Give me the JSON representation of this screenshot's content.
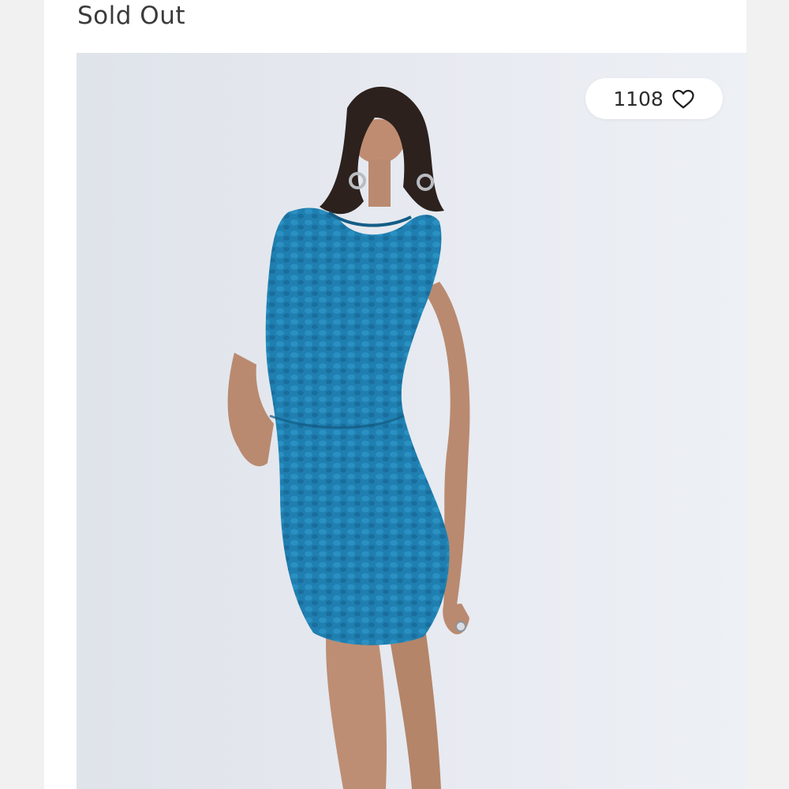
{
  "listing": {
    "status": "Sold Out",
    "likes": "1108"
  },
  "icons": {
    "like": "heart-outline-icon"
  },
  "colors": {
    "dress": "#1f7fb0",
    "background": "#e5e8ee"
  }
}
